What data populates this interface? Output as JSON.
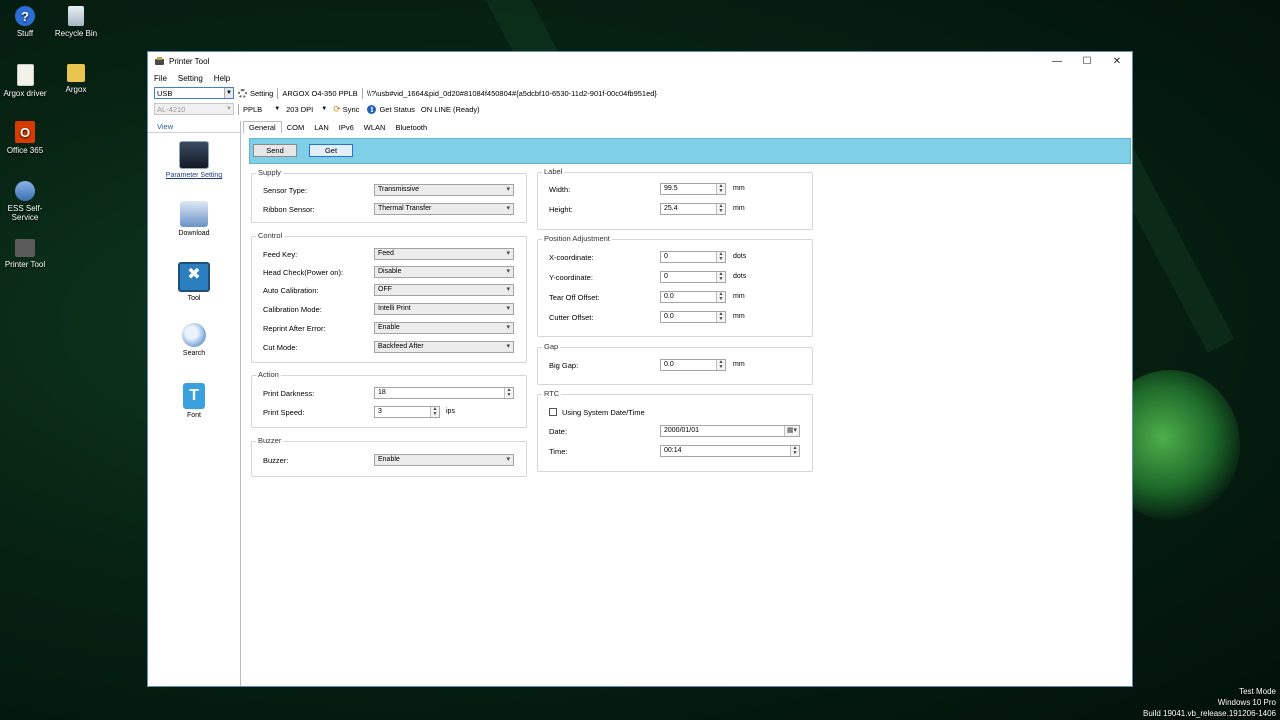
{
  "desktop": {
    "icons": [
      {
        "label": "Stuff"
      },
      {
        "label": "Recycle Bin"
      },
      {
        "label": "Argox driver"
      },
      {
        "label": "Argox"
      },
      {
        "label": "Office 365"
      },
      {
        "label": "ESS Self-Service"
      },
      {
        "label": "Printer Tool"
      }
    ],
    "watermark": {
      "line1": "Test Mode",
      "line2": "Windows 10 Pro",
      "line3": "Build 19041.vb_release.191206-1406"
    }
  },
  "window": {
    "title": "Printer Tool",
    "menu": [
      "File",
      "Setting",
      "Help"
    ],
    "toolbar": {
      "port_value": "USB",
      "setting_label": "Setting",
      "printer_name": "ARGOX O4-350 PPLB",
      "device_path": "\\\\?\\usb#vid_1664&pid_0d20#81084f450804#{a5dcbf10-6530-11d2-901f-00c04fb951ed}",
      "model_value": "AL-4210",
      "language_value": "PPLB",
      "dpi_value": "203 DPI",
      "sync_label": "Sync",
      "get_status_label": "Get Status",
      "status_text": "ON LINE (Ready)"
    },
    "sidebar": {
      "header": "View",
      "items": [
        {
          "label": "Parameter Setting"
        },
        {
          "label": "Download"
        },
        {
          "label": "Tool"
        },
        {
          "label": "Search"
        },
        {
          "label": "Font"
        }
      ]
    },
    "tabs": [
      "General",
      "COM",
      "LAN",
      "IPv6",
      "WLAN",
      "Bluetooth"
    ],
    "buttons": {
      "send": "Send",
      "get": "Get"
    },
    "supply": {
      "title": "Supply",
      "sensor_type_label": "Sensor Type:",
      "sensor_type_value": "Transmissive",
      "ribbon_sensor_label": "Ribbon Sensor:",
      "ribbon_sensor_value": "Thermal Transfer"
    },
    "control": {
      "title": "Control",
      "feed_key_label": "Feed Key:",
      "feed_key_value": "Feed",
      "head_check_label": "Head Check(Power on):",
      "head_check_value": "Disable",
      "auto_cal_label": "Auto Calibration:",
      "auto_cal_value": "OFF",
      "cal_mode_label": "Calibration Mode:",
      "cal_mode_value": "Intelli Print",
      "reprint_label": "Reprint After Error:",
      "reprint_value": "Enable",
      "cut_mode_label": "Cut Mode:",
      "cut_mode_value": "Backfeed After"
    },
    "action": {
      "title": "Action",
      "darkness_label": "Print Darkness:",
      "darkness_value": "18",
      "speed_label": "Print Speed:",
      "speed_value": "3",
      "speed_unit": "ips"
    },
    "buzzer": {
      "title": "Buzzer",
      "buzzer_label": "Buzzer:",
      "buzzer_value": "Enable"
    },
    "label": {
      "title": "Label",
      "width_label": "Width:",
      "width_value": "99.5",
      "width_unit": "mm",
      "height_label": "Height:",
      "height_value": "25.4",
      "height_unit": "mm"
    },
    "position": {
      "title": "Position Adjustment",
      "x_label": "X-coordinate:",
      "x_value": "0",
      "x_unit": "dots",
      "y_label": "Y-coordinate:",
      "y_value": "0",
      "y_unit": "dots",
      "tear_label": "Tear Off Offset:",
      "tear_value": "0.0",
      "tear_unit": "mm",
      "cutter_label": "Cutter Offset:",
      "cutter_value": "0.0",
      "cutter_unit": "mm"
    },
    "gap": {
      "title": "Gap",
      "big_gap_label": "Big Gap:",
      "big_gap_value": "0.0",
      "big_gap_unit": "mm"
    },
    "rtc": {
      "title": "RTC",
      "system_date_label": "Using System Date/Time",
      "date_label": "Date:",
      "date_value": "2000/01/01",
      "time_label": "Time:",
      "time_value": "00:14"
    }
  }
}
